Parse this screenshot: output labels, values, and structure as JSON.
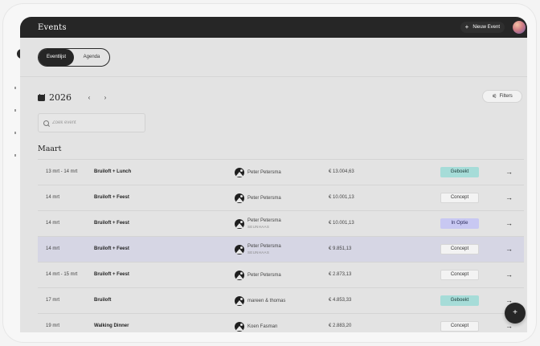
{
  "app": {
    "title": "Events"
  },
  "header": {
    "new_event_label": "Nieuw Event"
  },
  "view_toggle": {
    "list_label": "Eventlijst",
    "calendar_label": "Agenda"
  },
  "year_nav": {
    "year": "2026",
    "prev": "‹",
    "next": "›"
  },
  "filters": {
    "label": "Filters"
  },
  "search": {
    "placeholder": "Zoek event"
  },
  "month": "Maart",
  "events": [
    {
      "date": "13 mrt - 14 mrt",
      "name": "Bruiloft + Lunch",
      "client": "Peter Petersma",
      "client_sub": "",
      "amount": "€ 13.004,63",
      "status": "Geboekt",
      "status_kind": "geboekt"
    },
    {
      "date": "14 mrt",
      "name": "Bruiloft + Feest",
      "client": "Peter Petersma",
      "client_sub": "",
      "amount": "€ 10.001,13",
      "status": "Concept",
      "status_kind": "concept"
    },
    {
      "date": "14 mrt",
      "name": "Bruiloft + Feest",
      "client": "Peter Petersma",
      "client_sub": "SEUNHAAS",
      "amount": "€ 10.001,13",
      "status": "In Optie",
      "status_kind": "optie"
    },
    {
      "date": "14 mrt",
      "name": "Bruiloft + Feest",
      "client": "Peter Petersma",
      "client_sub": "SEUNHAAS",
      "amount": "€ 9.851,13",
      "status": "Concept",
      "status_kind": "concept"
    },
    {
      "date": "14 mrt - 15 mrt",
      "name": "Bruiloft + Feest",
      "client": "Peter Petersma",
      "client_sub": "",
      "amount": "€ 2.873,13",
      "status": "Concept",
      "status_kind": "concept"
    },
    {
      "date": "17 mrt",
      "name": "Bruiloft",
      "client": "mareen & thomas",
      "client_sub": "",
      "amount": "€ 4.853,33",
      "status": "Geboekt",
      "status_kind": "geboekt"
    },
    {
      "date": "19 mrt",
      "name": "Walking Dinner",
      "client": "Koen Fasman",
      "client_sub": "",
      "amount": "€ 2.883,20",
      "status": "Concept",
      "status_kind": "concept"
    }
  ],
  "fab": {
    "label": "+"
  },
  "colors": {
    "topbar": "#262626",
    "geboekt": "#a6dcd8",
    "optie": "#c8c8f2",
    "highlight_row": "#d6d6e4"
  },
  "icons": {
    "calendar": "calendar-icon",
    "search": "search-icon",
    "filter": "filter-icon",
    "arrow": "arrow-right-icon",
    "plus": "plus-icon"
  }
}
